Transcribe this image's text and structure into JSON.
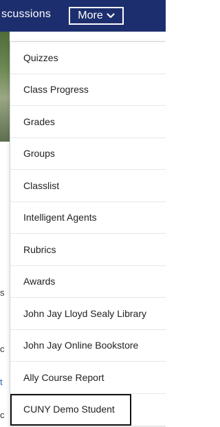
{
  "navbar": {
    "partial_item_label": "scussions",
    "more_button_label": "More"
  },
  "background_fragments": [
    "s",
    "c",
    "t",
    "c"
  ],
  "menu": {
    "items": [
      {
        "label": "Quizzes"
      },
      {
        "label": "Class Progress"
      },
      {
        "label": "Grades"
      },
      {
        "label": "Groups"
      },
      {
        "label": "Classlist"
      },
      {
        "label": "Intelligent Agents"
      },
      {
        "label": "Rubrics"
      },
      {
        "label": "Awards"
      },
      {
        "label": "John Jay Lloyd Sealy Library"
      },
      {
        "label": "John Jay Online Bookstore"
      },
      {
        "label": "Ally Course Report"
      },
      {
        "label": "CUNY Demo Student",
        "focused": true
      }
    ]
  },
  "colors": {
    "navbar_bg": "#1d2e6e",
    "menu_text": "#202122",
    "divider": "#e3e6e9"
  }
}
